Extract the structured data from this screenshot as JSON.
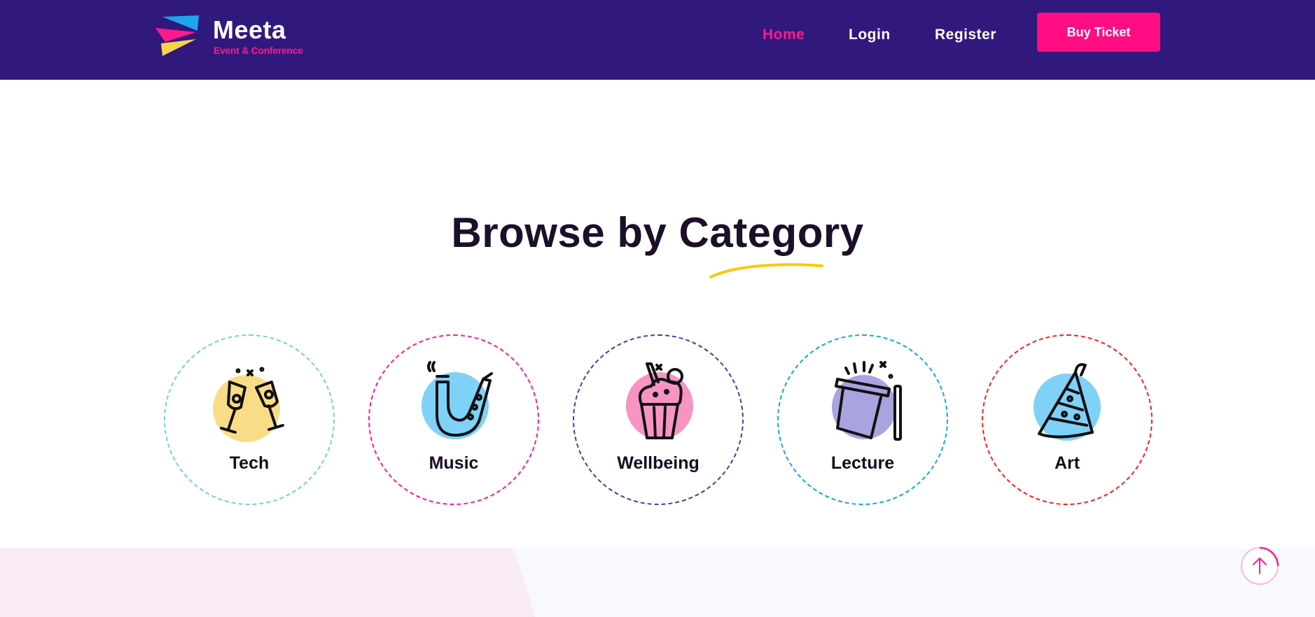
{
  "header": {
    "logo": {
      "name": "Meeta",
      "tagline": "Event & Conference"
    },
    "nav": [
      {
        "label": "Home",
        "active": true
      },
      {
        "label": "Login",
        "active": false
      },
      {
        "label": "Register",
        "active": false
      }
    ],
    "cta_label": "Buy Ticket"
  },
  "main": {
    "title": "Browse by Category",
    "categories": [
      {
        "label": "Tech",
        "icon": "champagne-glasses-icon",
        "accent": "#f9dd86",
        "border": "#6fd0e6"
      },
      {
        "label": "Music",
        "icon": "saxophone-icon",
        "accent": "#80d1f7",
        "border": "#ff1a8c"
      },
      {
        "label": "Wellbeing",
        "icon": "cupcake-icon",
        "accent": "#f794c4",
        "border": "#4a3aa3"
      },
      {
        "label": "Lecture",
        "icon": "magic-hat-icon",
        "accent": "#a9a3e0",
        "border": "#10a8d6"
      },
      {
        "label": "Art",
        "icon": "party-hat-icon",
        "accent": "#80d1f7",
        "border": "#ff1a1a"
      }
    ]
  },
  "colors": {
    "header_bg": "#31187c",
    "accent_pink": "#ff0d82",
    "title_underline": "#f7c90e"
  },
  "scroll_top": {
    "icon": "arrow-up-icon"
  }
}
